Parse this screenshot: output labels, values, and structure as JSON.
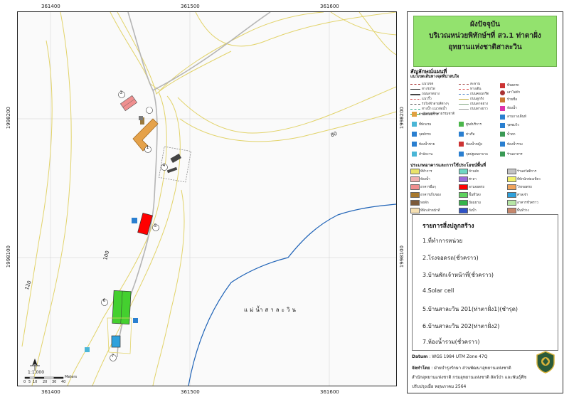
{
  "map": {
    "coords_top": [
      "361400",
      "361500",
      "361600"
    ],
    "coords_bottom": [
      "361400",
      "361500",
      "361600"
    ],
    "coords_left": [
      "1998200",
      "1998100"
    ],
    "coords_right": [
      "1998200",
      "1998100"
    ],
    "contour_labels": [
      "80",
      "100",
      "120"
    ],
    "river_label": "แม่น้ำสาละวิน",
    "building_numbers": [
      "1",
      "2",
      "3",
      "4",
      "5",
      "6",
      "7"
    ],
    "scale": {
      "ratio": "1:1,000",
      "ticks": [
        "0",
        "5",
        "10",
        "20",
        "30",
        "40"
      ],
      "unit": "Meters"
    }
  },
  "title": {
    "line1": "ผังปัจจุบัน",
    "line2": "บริเวณหน่วยพิทักษ์ฯที่ สว.1 ท่าตาฝั่ง",
    "line3": "อุทยานแห่งชาติสาละวิน"
  },
  "legend": {
    "heading": "สัญลักษณ์แผนที่",
    "sub_heading": "แนวเขตเส้นทางจุดที่น่าสนใจ",
    "lines": [
      "แนวเขต",
      "ทางรถไฟ",
      "ถนนลาดยาง",
      "แนวรั้ว",
      "รถไฟฟ้าสายสีต่างๆ",
      "ทางน้ำ แนวท่อน้ำ",
      "เส้นทางศึกษาธรรมชาติ",
      "สะพาน",
      "ทางเดิน",
      "ถนนคอนกรีต",
      "ถนนลูกรัง",
      "ถนนลาดยาง",
      "ถนนทางยาว"
    ],
    "points": [
      "ที่จอดรถ",
      "เสาไฟฟ้า",
      "ป้ายชื่อ",
      "ห้องน้ำ",
      "ลานกางเต็นท์",
      "จุดชมวิว",
      "ที่พักแรม",
      "ศูนย์บริการ",
      "จุดพักรถ",
      "ท่าเรือ",
      "น้ำตก",
      "ห้องน้ำชาย",
      "ห้องน้ำหญิง",
      "ห้องน้ำรวม",
      "สำนักงาน",
      "จุดปฐมพยาบาล",
      "ร้านอาหาร",
      "ร้านสวัสดิการ"
    ],
    "landuse_heading": "ประเภทอาคารและการใช้ประโยชน์พื้นที่",
    "landuse": [
      {
        "label": "ที่ทำการ",
        "color": "#e9e36a"
      },
      {
        "label": "บ้านพัก",
        "color": "#6fd7c4"
      },
      {
        "label": "ร้านสวัสดิการ",
        "color": "#c3c3c3"
      },
      {
        "label": "ห้องน้ำ",
        "color": "#f0b1b1"
      },
      {
        "label": "ศาลา",
        "color": "#9a6cd9"
      },
      {
        "label": "ที่พักนักท่องเที่ยว",
        "color": "#f2f26b"
      },
      {
        "label": "อาคารอื่นๆ",
        "color": "#ef8f8f"
      },
      {
        "label": "ลานจอดรถ",
        "color": "#ff0000"
      },
      {
        "label": "โรงจอดรถ",
        "color": "#f0a35b"
      },
      {
        "label": "อาคารเก็บของ",
        "color": "#a8792e"
      },
      {
        "label": "พื้นที่โล่ง",
        "color": "#5fd35f"
      },
      {
        "label": "ศาลเจ้า",
        "color": "#2ea1dc"
      },
      {
        "label": "หอพัก",
        "color": "#7b5a3a"
      },
      {
        "label": "ป้อมยาม",
        "color": "#34b34a"
      },
      {
        "label": "อาคารชั่วคราว",
        "color": "#b6e6a5"
      },
      {
        "label": "ที่พักเจ้าหน้าที่",
        "color": "#f6e0b2"
      },
      {
        "label": "ถังน้ำ",
        "color": "#2f52c6"
      },
      {
        "label": "พื้นที่ว่าง",
        "color": "#c7876b"
      }
    ]
  },
  "buildings": {
    "heading": "รายการสิ่งปลูกสร้าง",
    "items": [
      "1.ที่ทำการหน่วย",
      "2.โรงจอดรถ(ชั่วคราว)",
      "3.บ้านพักเจ้าหน้าที่(ชั่วคราว)",
      "4.Solar cell",
      "5.บ้านสาละวิน 201(ท่าตาฝั่ง1)(ชำรุด)",
      "6.บ้านสาละวิน 202(ท่าตาฝั่ง2)",
      "7.ห้องน้ำรวม(ชั่วคราว)"
    ]
  },
  "meta": {
    "datum_label": "Datum",
    "datum_value": ": WGS 1984 UTM Zone 47Q",
    "made_by_label": "จัดทำโดย",
    "made_by_value": ": ฝ่ายบำรุงรักษา ส่วนพัฒนาอุทยานแห่งชาติ",
    "org": "สำนักอุทยานแห่งชาติ กรมอุทยานแห่งชาติ สัตว์ป่า และพันธุ์พืช",
    "updated": "ปรับปรุงเมื่อ พฤษภาคม 2564"
  }
}
